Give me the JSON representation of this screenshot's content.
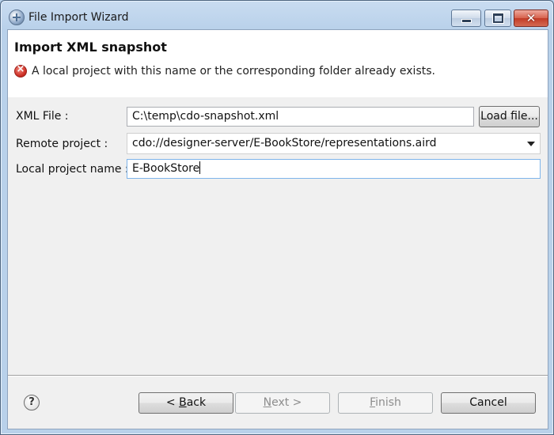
{
  "window": {
    "title": "File Import Wizard",
    "minimize_icon": "minimize-icon",
    "maximize_icon": "maximize-icon",
    "close_symbol": "✕"
  },
  "header": {
    "title": "Import XML snapshot",
    "error_message": "A local project with this name or the corresponding folder already exists."
  },
  "form": {
    "xml_file": {
      "label": "XML File :",
      "value": "C:\\temp\\cdo-snapshot.xml"
    },
    "load_button": "Load file...",
    "remote_project": {
      "label": "Remote project :",
      "value": "cdo://designer-server/E-BookStore/representations.aird"
    },
    "local_project": {
      "label": "Local project name :",
      "value": "E-BookStore"
    }
  },
  "buttons": {
    "back": {
      "prefix": "< ",
      "mnemonic": "B",
      "rest": "ack"
    },
    "next": {
      "mnemonic": "N",
      "rest": "ext >"
    },
    "finish": {
      "mnemonic": "F",
      "rest": "inish"
    },
    "cancel": "Cancel"
  },
  "help": {
    "symbol": "?"
  }
}
